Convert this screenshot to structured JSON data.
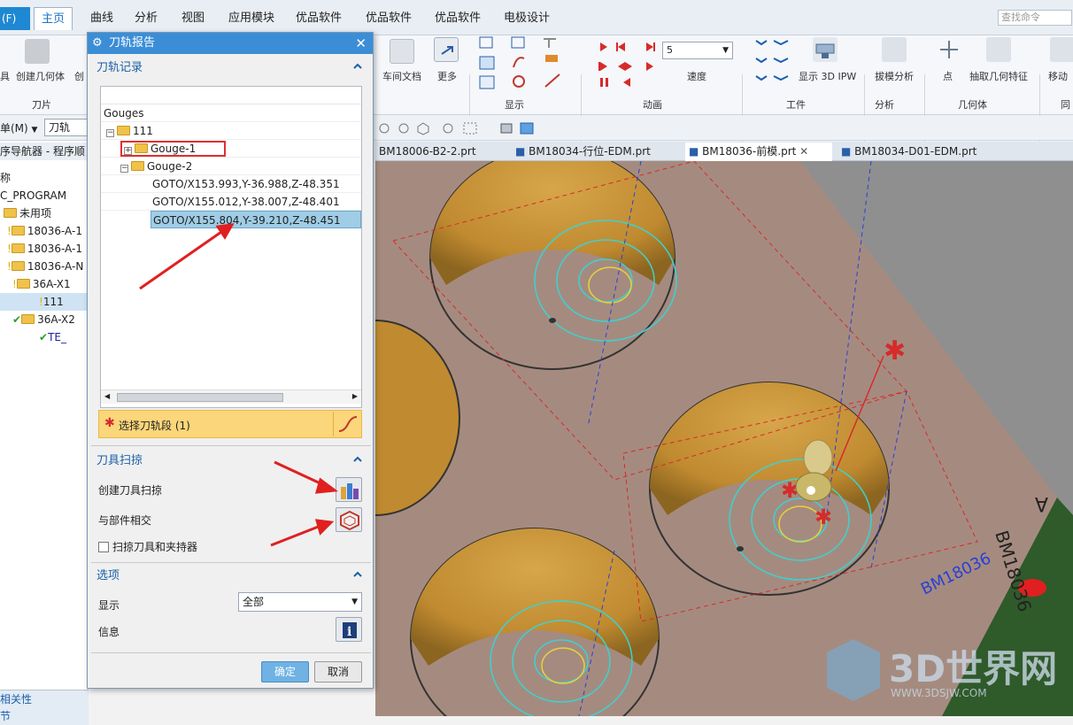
{
  "menubar": {
    "file": "(F)",
    "items": [
      "主页",
      "曲线",
      "分析",
      "视图",
      "应用模块",
      "优品软件",
      "优品软件",
      "优品软件",
      "电极设计"
    ],
    "search_placeholder": "查找命令"
  },
  "ribbon": {
    "left_labels": [
      "具",
      "创建几何体",
      "创"
    ],
    "blade_group": "刀片",
    "workshop_doc": "车间文档",
    "more": "更多",
    "display_group": "显示",
    "speed_value": "5",
    "speed_label": "速度",
    "animation_group": "动画",
    "show_ipw": "显示 3D IPW",
    "tool_group": "工件",
    "draft_analysis": "拔模分析",
    "analysis_group": "分析",
    "point": "点",
    "extract_geom": "抽取几何特征",
    "geometry_group": "几何体",
    "move_label": "移动",
    "trailing": "同"
  },
  "toolbar2": {
    "menu_label": "单(M)",
    "filter_value": "刀轨"
  },
  "navigator": {
    "title": "序导航器 - 程序顺",
    "col_header": "称",
    "rows": [
      "C_PROGRAM",
      "未用项",
      "18036-A-1",
      "18036-A-1",
      "18036-A-N",
      "36A-X1",
      "111",
      "36A-X2",
      "TE_"
    ],
    "bottom": [
      "相关性",
      "节"
    ]
  },
  "doctabs": [
    "BM18006-B2-2.prt",
    "BM18034-行位-EDM.prt",
    "BM18036-前模.prt",
    "BM18034-D01-EDM.prt"
  ],
  "dialog": {
    "title": "刀轨报告",
    "section_record": "刀轨记录",
    "tree": {
      "root": "Gouges",
      "program": "111",
      "gouge1": "Gouge-1",
      "gouge2": "Gouge-2",
      "goto": [
        "GOTO/X153.993,Y-36.988,Z-48.351",
        "GOTO/X155.012,Y-38.007,Z-48.401",
        "GOTO/X155.804,Y-39.210,Z-48.451"
      ]
    },
    "select_segment": "选择刀轨段 (1)",
    "section_sweep": "刀具扫掠",
    "create_sweep": "创建刀具扫掠",
    "intersect_part": "与部件相交",
    "sweep_holder": "扫掠刀具和夹持器",
    "section_options": "选项",
    "display_label": "显示",
    "display_value": "全部",
    "info_label": "信息",
    "ok": "确定",
    "cancel": "取消"
  },
  "viewport": {
    "part_label": "BM18036",
    "part_label_blue": "BM18036",
    "letter": "A",
    "watermark": "3D世界网",
    "watermark_url": "WWW.3DSJW.COM"
  }
}
